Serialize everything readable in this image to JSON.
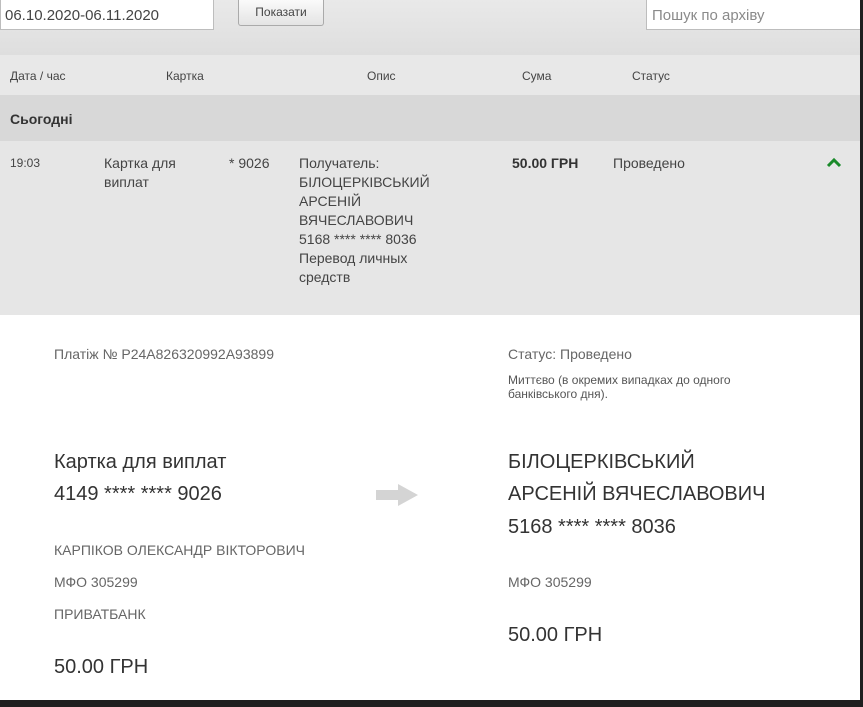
{
  "filters": {
    "date_range": "06.10.2020-06.11.2020",
    "show_button": "Показати",
    "search_placeholder": "Пошук по архіву"
  },
  "table": {
    "headers": [
      "Дата / час",
      "Картка",
      "Опис",
      "Сума",
      "Статус"
    ],
    "group_label": "Сьогодні",
    "row": {
      "time": "19:03",
      "card_name": [
        "Картка для",
        "виплат"
      ],
      "card_number": "* 9026",
      "description": [
        "Получатель:",
        "БІЛОЦЕРКІВСЬКИЙ",
        "АРСЕНІЙ",
        "ВЯЧЕСЛАВОВИЧ",
        "5168 **** **** 8036",
        "Перевод личных",
        "средств"
      ],
      "amount": "50.00 ГРН",
      "status": "Проведено"
    }
  },
  "details": {
    "payment_number": "Платіж № P24A826320992A93899",
    "status_line": "Статус: Проведено",
    "status_note": [
      "Миттєво (в окремих випадках до одного",
      "банківського дня)."
    ],
    "sender": {
      "card_name": "Картка для виплат",
      "card_number": "4149 **** **** 9026",
      "owner": "КАРПІКОВ ОЛЕКСАНДР ВІКТОРОВИЧ",
      "mfo": "МФО 305299",
      "bank": "ПРИВАТБАНК",
      "amount": "50.00 ГРН"
    },
    "receiver": {
      "name_line1": "БІЛОЦЕРКІВСЬКИЙ",
      "name_line2": "АРСЕНІЙ ВЯЧЕСЛАВОВИЧ",
      "card_number": "5168 **** **** 8036",
      "mfo": "МФО 305299",
      "amount": "50.00 ГРН"
    }
  },
  "icons": {
    "collapse": "chevron-up-icon",
    "transfer": "arrow-right-icon"
  },
  "colors": {
    "accent_green": "#1a8a2a",
    "arrow_gray": "#d4d4d4"
  }
}
